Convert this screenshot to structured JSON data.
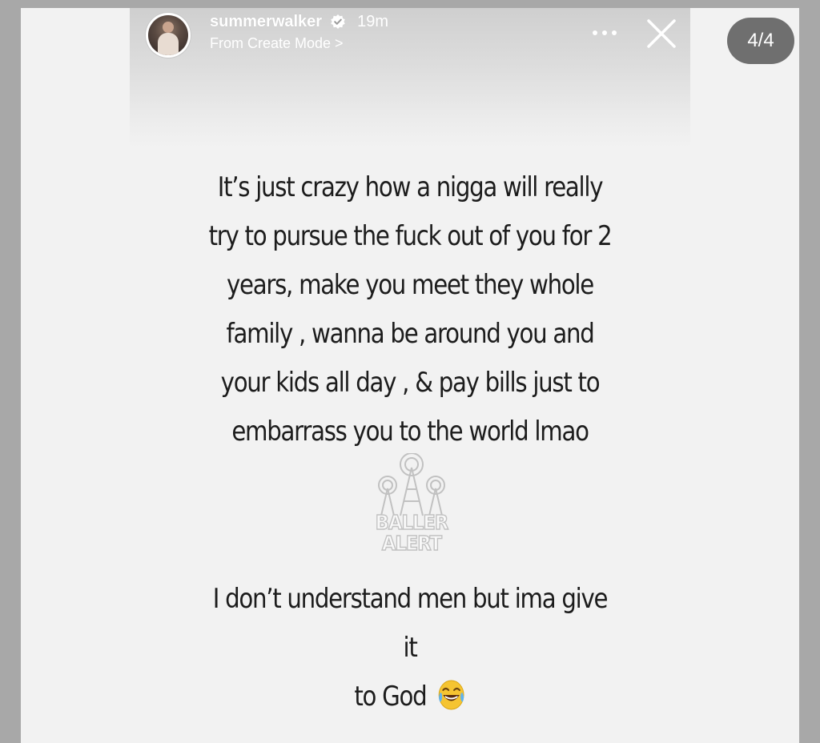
{
  "header": {
    "username": "summerwalker",
    "time": "19m",
    "subline": "From Create Mode >"
  },
  "counter": "4/4",
  "story": {
    "paragraph1_lines": [
      "It’s just crazy how a nigga will really",
      "try to pursue the fuck out of you for 2",
      "years, make you meet they whole",
      "family , wanna be around you and",
      "your kids all day , & pay bills just to",
      "embarrass you to the world lmao"
    ],
    "paragraph2_lines": [
      "I don’t understand men but ima give it",
      "to God"
    ]
  },
  "watermark": {
    "line1": "BALLER",
    "line2": "ALERT"
  },
  "icons": {
    "verified": "verified-badge-icon",
    "more": "more-options-icon",
    "close": "close-icon",
    "emoji": "face-with-tears-of-joy-emoji"
  },
  "colors": {
    "background": "#f2f2f2",
    "counter_bg": "#6f6f6f",
    "text": "#1c1c1c"
  }
}
